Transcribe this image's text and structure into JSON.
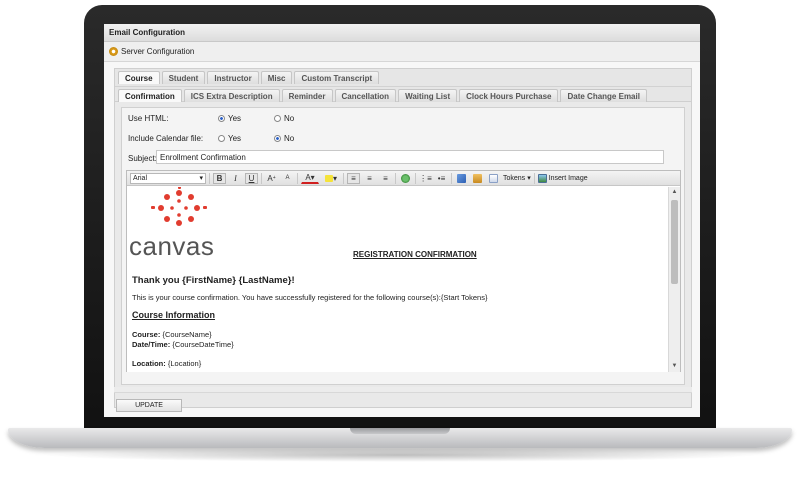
{
  "window": {
    "title": "Email Configuration"
  },
  "server_bar": {
    "label": "Server Configuration"
  },
  "tabs_primary": [
    "Course",
    "Student",
    "Instructor",
    "Misc",
    "Custom Transcript"
  ],
  "tabs_secondary": [
    "Confirmation",
    "ICS Extra Description",
    "Reminder",
    "Cancellation",
    "Waiting List",
    "Clock Hours Purchase",
    "Date Change Email"
  ],
  "form": {
    "use_html_label": "Use HTML:",
    "include_calendar_label": "Include Calendar file:",
    "yes_label": "Yes",
    "no_label": "No",
    "use_html_selected": "Yes",
    "include_calendar_selected": "No",
    "subject_label": "Subject:",
    "subject_value": "Enrollment Confirmation"
  },
  "toolbar": {
    "font": "Arial",
    "bold": "B",
    "italic": "I",
    "underline": "U",
    "tokens_label": "Tokens",
    "insert_image_label": "Insert Image"
  },
  "document": {
    "logo_text": "canvas",
    "registration_title": "REGISTRATION CONFIRMATION",
    "thank_you": "Thank you {FirstName} {LastName}!",
    "intro": "This is your course confirmation. You have successfully registered for the following course(s):{Start Tokens}",
    "course_info_heading": "Course Information",
    "course_label": "Course:",
    "course_value": "{CourseName}",
    "datetime_label": "Date/Time:",
    "datetime_value": "{CourseDateTime}",
    "location_label": "Location:",
    "location_value": "{Location}"
  },
  "actions": {
    "update_label": "UPDATE"
  },
  "colors": {
    "logo_red": "#e13c2f",
    "radio_blue": "#2a60c8"
  }
}
